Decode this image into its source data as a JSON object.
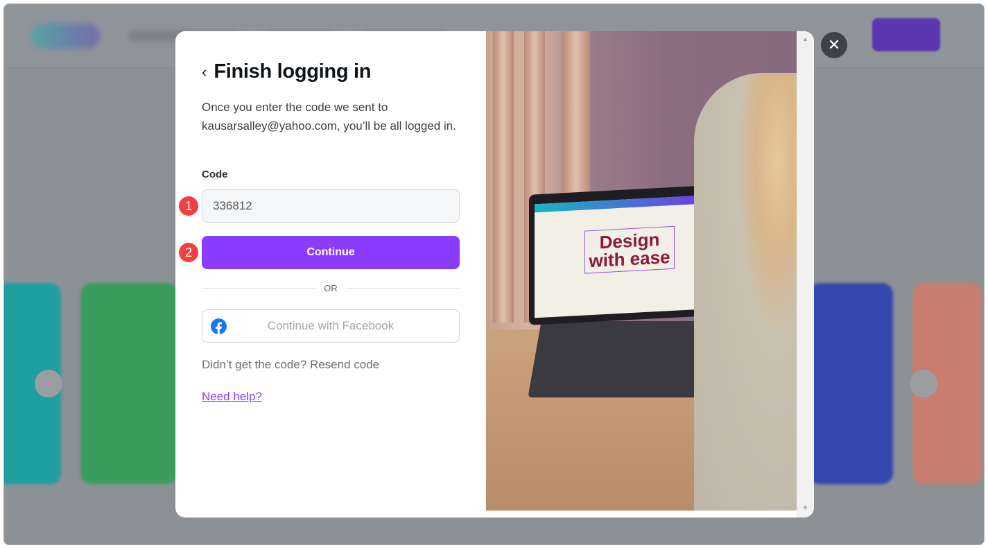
{
  "modal": {
    "title": "Finish logging in",
    "description": "Once you enter the code we sent to kausarsalley@yahoo.com, you’ll be all logged in.",
    "code_label": "Code",
    "code_value": "336812",
    "continue_label": "Continue",
    "or_label": "OR",
    "facebook_label": "Continue with Facebook",
    "resend_text": "Didn’t get the code? Resend code",
    "help_link": "Need help?",
    "annotations": [
      "1",
      "2"
    ],
    "image_text": "Design with ease"
  },
  "colors": {
    "accent": "#8b3dff",
    "badge": "#f23f3f",
    "facebook": "#1877f2"
  },
  "icons": {
    "back": "chevron-left-icon",
    "close": "close-icon",
    "facebook": "facebook-icon"
  }
}
